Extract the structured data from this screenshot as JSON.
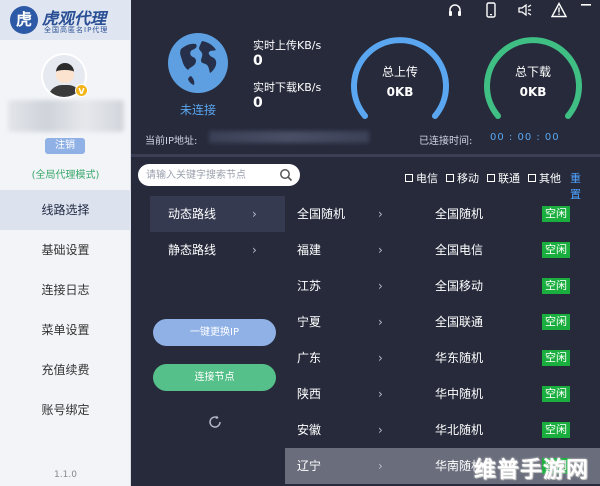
{
  "brand": {
    "title": "虎观代理",
    "subtitle": "全国高匿名IP代理",
    "vip_badge": "V"
  },
  "sidebar": {
    "logout_label": "注销",
    "mode": "(全局代理模式)",
    "items": [
      {
        "label": "线路选择",
        "active": true
      },
      {
        "label": "基础设置",
        "active": false
      },
      {
        "label": "连接日志",
        "active": false
      },
      {
        "label": "菜单设置",
        "active": false
      },
      {
        "label": "充值续费",
        "active": false
      },
      {
        "label": "账号绑定",
        "active": false
      }
    ],
    "version": "1.1.0"
  },
  "window_icons": [
    "headset-icon",
    "phone-icon",
    "speaker-icon",
    "alert-icon",
    "minimize-icon",
    "close-icon"
  ],
  "status": {
    "connection": "未连接",
    "realtime_upload_label": "实时上传KB/s",
    "realtime_upload_value": "0",
    "realtime_download_label": "实时下载KB/s",
    "realtime_download_value": "0",
    "total_upload_label": "总上传",
    "total_upload_value": "0KB",
    "total_download_label": "总下载",
    "total_download_value": "0KB",
    "current_ip_label": "当前IP地址:",
    "connected_time_label": "已连接时间:",
    "connected_time_value": "00 : 00 : 00"
  },
  "search": {
    "placeholder": "请输入关键字搜索节点"
  },
  "filters": {
    "options": [
      "电信",
      "移动",
      "联通",
      "其他"
    ],
    "reset_label": "重置"
  },
  "route_types": [
    {
      "label": "动态路线",
      "arrow": "›",
      "active": true
    },
    {
      "label": "静态路线",
      "arrow": "›",
      "active": false
    }
  ],
  "buttons": {
    "switch_ip": "一键更换IP",
    "connect": "连接节点"
  },
  "routes": [
    {
      "province": "全国随机",
      "arrow": "›",
      "node": "全国随机",
      "status": "空闲"
    },
    {
      "province": "福建",
      "arrow": "›",
      "node": "全国电信",
      "status": "空闲"
    },
    {
      "province": "江苏",
      "arrow": "›",
      "node": "全国移动",
      "status": "空闲"
    },
    {
      "province": "宁夏",
      "arrow": "›",
      "node": "全国联通",
      "status": "空闲"
    },
    {
      "province": "广东",
      "arrow": "›",
      "node": "华东随机",
      "status": "空闲"
    },
    {
      "province": "陕西",
      "arrow": "›",
      "node": "华中随机",
      "status": "空闲"
    },
    {
      "province": "安徽",
      "arrow": "›",
      "node": "华北随机",
      "status": "空闲"
    },
    {
      "province": "辽宁",
      "arrow": "›",
      "node": "华南随机",
      "status": "空闲"
    }
  ],
  "watermark": "维普手游网",
  "colors": {
    "panel_bg": "#262a3b",
    "accent_blue": "#5aa6f0",
    "accent_green": "#3fbf84",
    "status_green": "#1aae3e"
  }
}
